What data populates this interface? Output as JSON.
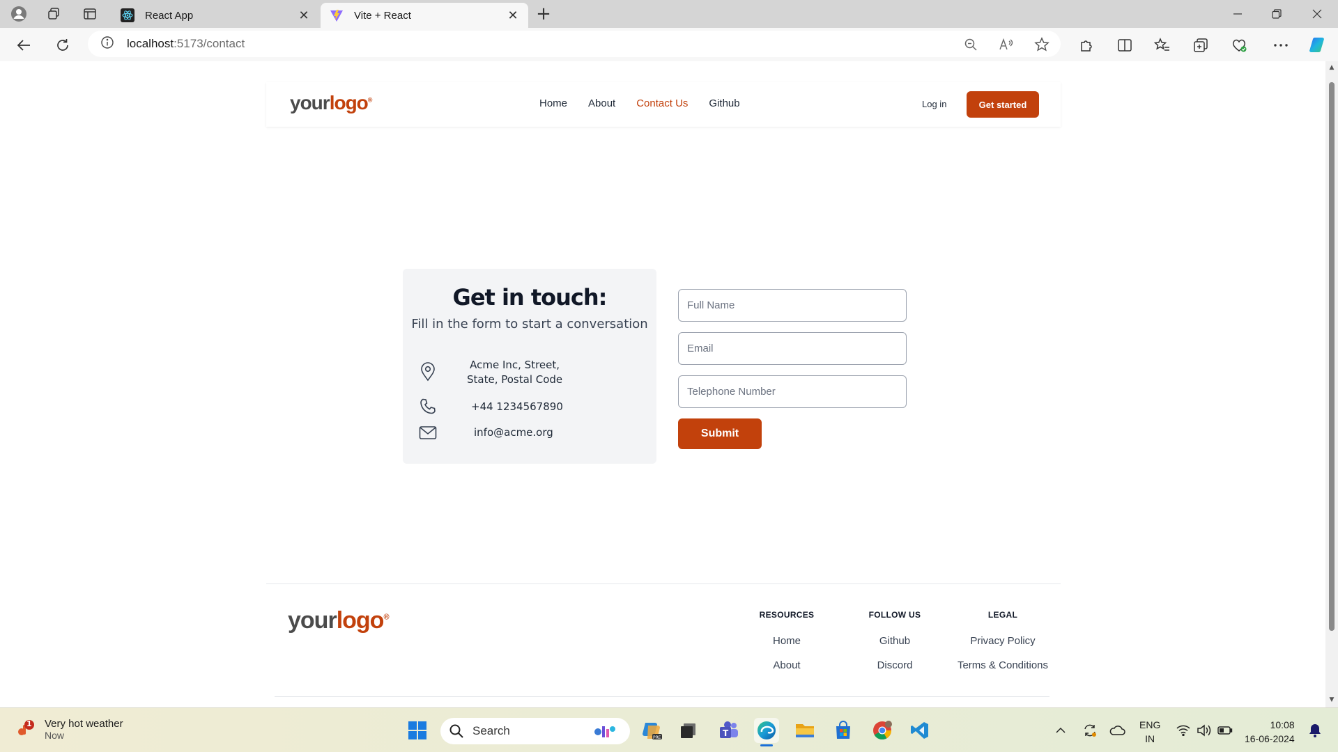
{
  "browser": {
    "tabs": [
      {
        "label": "React App",
        "icon": "react-icon",
        "active": false
      },
      {
        "label": "Vite + React",
        "icon": "vite-icon",
        "active": true
      }
    ],
    "url_host": "localhost",
    "url_path": ":5173/contact"
  },
  "header": {
    "logo_your": "your",
    "logo_mark": "logo",
    "logo_reg": "®",
    "nav": [
      {
        "label": "Home",
        "active": false
      },
      {
        "label": "About",
        "active": false
      },
      {
        "label": "Contact Us",
        "active": true
      },
      {
        "label": "Github",
        "active": false
      }
    ],
    "login_label": "Log in",
    "cta_label": "Get started"
  },
  "contact": {
    "title": "Get in touch:",
    "subtitle": "Fill in the form to start a conversation",
    "address_line1": "Acme Inc, Street,",
    "address_line2": "State, Postal Code",
    "phone": "+44 1234567890",
    "email": "info@acme.org"
  },
  "form": {
    "name_placeholder": "Full Name",
    "email_placeholder": "Email",
    "phone_placeholder": "Telephone Number",
    "submit_label": "Submit"
  },
  "footer": {
    "columns": [
      {
        "heading": "RESOURCES",
        "links": [
          "Home",
          "About"
        ]
      },
      {
        "heading": "FOLLOW US",
        "links": [
          "Github",
          "Discord"
        ]
      },
      {
        "heading": "LEGAL",
        "links": [
          "Privacy Policy",
          "Terms & Conditions"
        ]
      }
    ]
  },
  "taskbar": {
    "weather_title": "Very hot weather",
    "weather_sub": "Now",
    "weather_badge": "1",
    "search_label": "Search",
    "lang_line1": "ENG",
    "lang_line2": "IN",
    "time": "10:08",
    "date": "16-06-2024"
  },
  "colors": {
    "accent": "#c2410c",
    "card_bg": "#f3f4f6",
    "text_dark": "#111827"
  }
}
